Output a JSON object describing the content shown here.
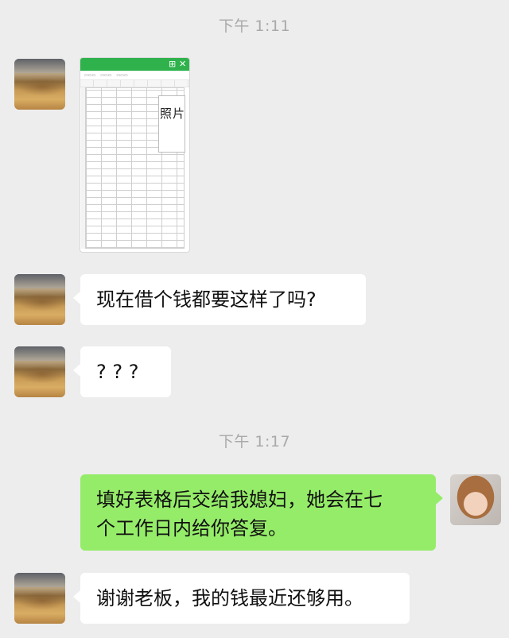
{
  "chat": {
    "timestamp1": "下午 1:11",
    "timestamp2": "下午 1:17",
    "messages": [
      {
        "side": "left",
        "type": "image",
        "image": {
          "photo_label": "照片"
        }
      },
      {
        "side": "left",
        "type": "text",
        "text": "现在借个钱都要这样了吗?"
      },
      {
        "side": "left",
        "type": "text",
        "text": "? ? ?"
      },
      {
        "side": "right",
        "type": "text",
        "text_line1": "填好表格后交给我媳妇，她会在七",
        "text_line2": "个工作日内给你答复。"
      },
      {
        "side": "left",
        "type": "text",
        "text": "谢谢老板，我的钱最近还够用。"
      }
    ]
  },
  "colors": {
    "background": "#ededed",
    "timestamp": "#a9a9a9",
    "bubble_in": "#ffffff",
    "bubble_out": "#95ec69",
    "sheet_header": "#2fb24c"
  },
  "icons": {
    "sheet_grid_icon": "grid-icon",
    "sheet_close_icon": "close-icon"
  }
}
